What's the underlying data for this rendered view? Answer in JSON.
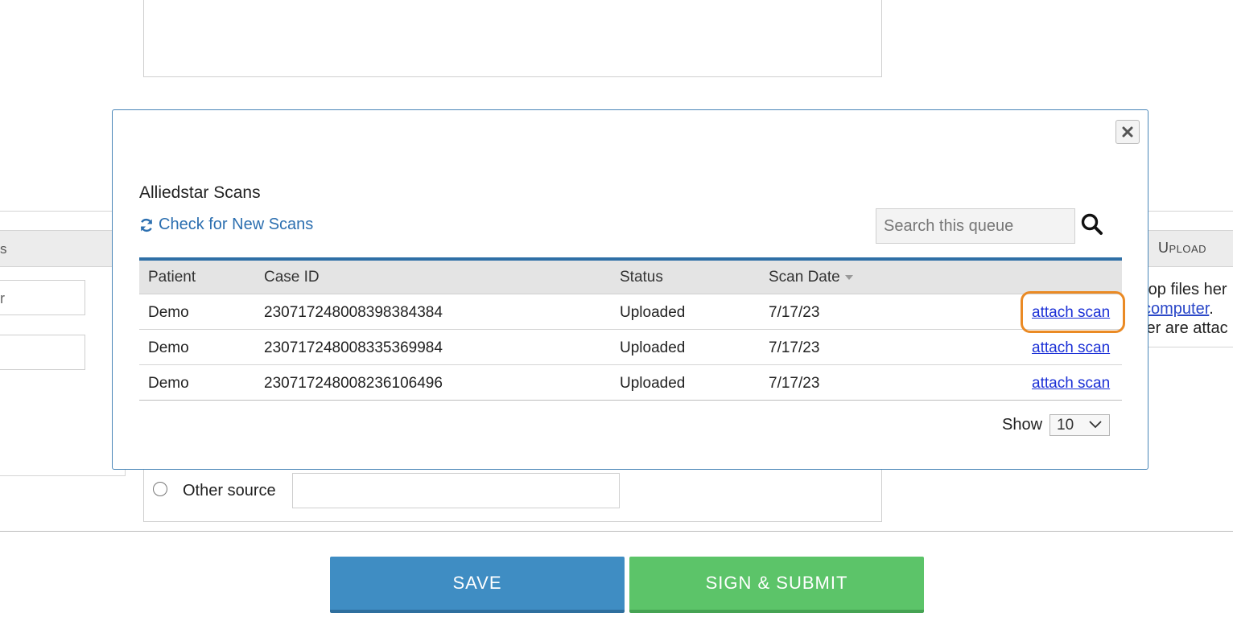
{
  "background": {
    "left_panel": {
      "header_fragment": "s",
      "input_fragment": "r"
    },
    "right_panel": {
      "header": "Upload",
      "line1": "rop files her",
      "link": "computer",
      "line2_suffix": ".",
      "line3": "ler are attac"
    },
    "other_source_label": "Other source",
    "save_label": "SAVE",
    "submit_label": "SIGN & SUBMIT"
  },
  "modal": {
    "title": "Alliedstar Scans",
    "check_link": "Check for New Scans",
    "search_placeholder": "Search this queue",
    "columns": [
      "Patient",
      "Case ID",
      "Status",
      "Scan Date"
    ],
    "rows": [
      {
        "patient": "Demo",
        "case_id": "230717248008398384384",
        "status": "Uploaded",
        "scan_date": "7/17/23",
        "action": "attach scan"
      },
      {
        "patient": "Demo",
        "case_id": "230717248008335369984",
        "status": "Uploaded",
        "scan_date": "7/17/23",
        "action": "attach scan"
      },
      {
        "patient": "Demo",
        "case_id": "230717248008236106496",
        "status": "Uploaded",
        "scan_date": "7/17/23",
        "action": "attach scan"
      }
    ],
    "show_label": "Show",
    "show_value": "10"
  },
  "colors": {
    "accent_link": "#2c6fb0",
    "table_top_border": "#2f6fa6",
    "highlight": "#ea8a24",
    "save_button": "#3f8dc3",
    "submit_button": "#5cc469"
  }
}
